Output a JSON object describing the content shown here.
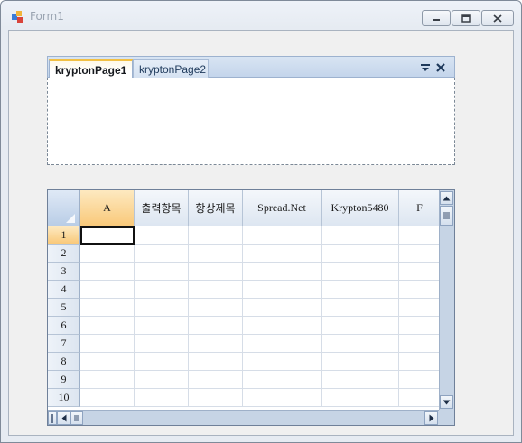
{
  "window": {
    "title": "Form1",
    "minimize_icon": "minimize-icon",
    "maximize_icon": "maximize-icon",
    "close_icon": "close-icon"
  },
  "navigator": {
    "tabs": [
      {
        "label": "kryptonPage1",
        "active": true
      },
      {
        "label": "kryptonPage2",
        "active": false
      }
    ],
    "dropdown_icon": "dropdown-arrow-icon",
    "close_icon": "close-x-icon"
  },
  "spread": {
    "columns": [
      "A",
      "출력항목",
      "항상제목",
      "Spread.Net",
      "Krypton5480",
      "F"
    ],
    "rows": [
      "1",
      "2",
      "3",
      "4",
      "5",
      "6",
      "7",
      "8",
      "9",
      "10"
    ],
    "active_cell": {
      "row": "1",
      "column": "A"
    },
    "colors": {
      "active_header": "#f9c97a",
      "scrollbar": "#c6d4e5"
    }
  }
}
